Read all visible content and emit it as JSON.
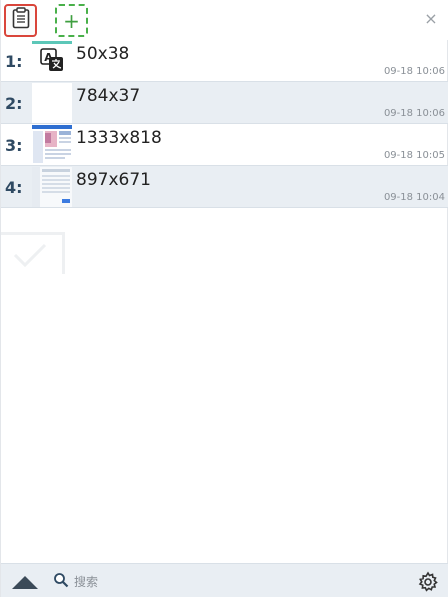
{
  "toolbar": {
    "clipboard_icon": "clipboard-icon",
    "add_icon": "plus-icon",
    "add_label": "+",
    "close_label": "×"
  },
  "items": [
    {
      "index": "1:",
      "title": "50x38",
      "time": "09-18 10:06",
      "thumb": "translate-icon"
    },
    {
      "index": "2:",
      "title": "784x37",
      "time": "09-18 10:06",
      "thumb": "striped-image"
    },
    {
      "index": "3:",
      "title": "1333x818",
      "time": "09-18 10:05",
      "thumb": "webpage-image"
    },
    {
      "index": "4:",
      "title": "897x671",
      "time": "09-18 10:04",
      "thumb": "dashboard-image"
    }
  ],
  "bottombar": {
    "up_icon": "triangle-up-icon",
    "search_icon": "magnifier-icon",
    "search_placeholder": "搜索",
    "settings_icon": "gear-icon"
  },
  "colors": {
    "accent_red": "#d9453a",
    "accent_green": "#49b04a",
    "row_alt": "#e9eef3",
    "index_text": "#2f4a63"
  }
}
